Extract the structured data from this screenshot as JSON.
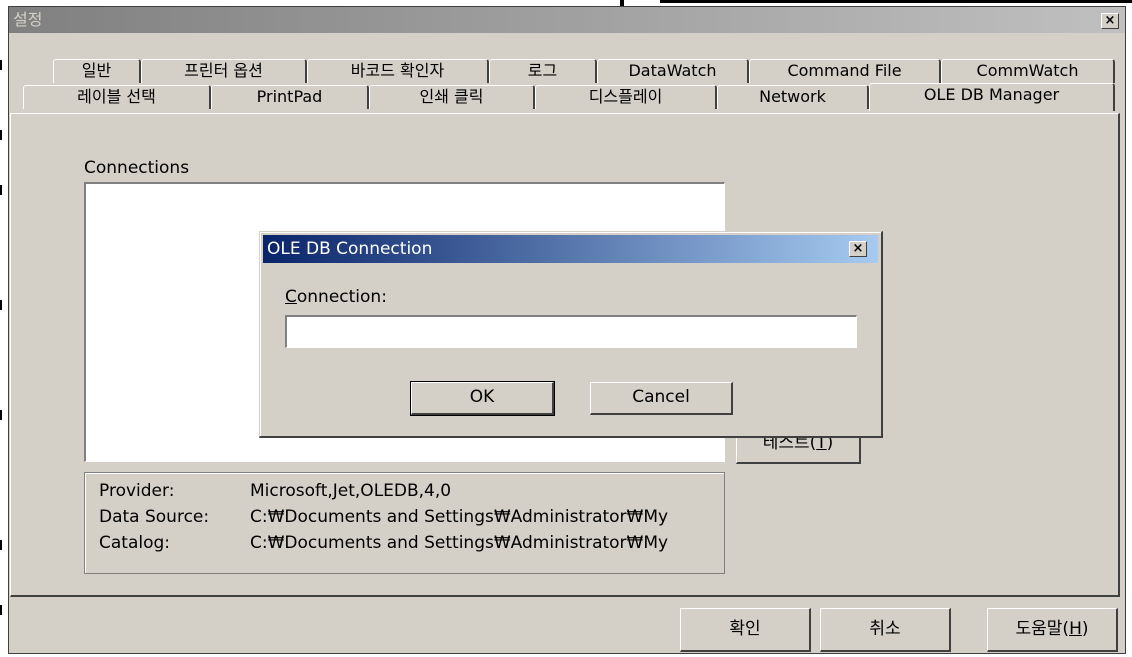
{
  "window": {
    "title": "설정",
    "close_glyph": "×"
  },
  "tabs_row1": [
    "일반",
    "프린터 옵션",
    "바코드 확인자",
    "로그",
    "DataWatch",
    "Command File",
    "CommWatch"
  ],
  "tabs_row2": [
    "레이블 선택",
    "PrintPad",
    "인쇄 클릭",
    "디스플레이",
    "Network",
    "OLE DB Manager"
  ],
  "panel": {
    "connections_label": "Connections",
    "test_button_label": "테스트(",
    "test_button_mnemonic": "T",
    "test_button_suffix": ")"
  },
  "info": {
    "rows": [
      {
        "key": "Provider:",
        "value": "Microsoft,Jet,OLEDB,4,0"
      },
      {
        "key": "Data Source:",
        "value": "C:₩Documents and Settings₩Administrator₩My"
      },
      {
        "key": "Catalog:",
        "value": "C:₩Documents and Settings₩Administrator₩My"
      }
    ]
  },
  "dialog": {
    "title": "OLE DB Connection",
    "close_glyph": "×",
    "field_label_mnemonic": "C",
    "field_label_rest": "onnection:",
    "field_value": "",
    "ok_label": "OK",
    "cancel_label": "Cancel"
  },
  "footer": {
    "ok_label": "확인",
    "cancel_label": "취소",
    "help_label": "도움말(",
    "help_mnemonic": "H",
    "help_suffix": ")"
  }
}
